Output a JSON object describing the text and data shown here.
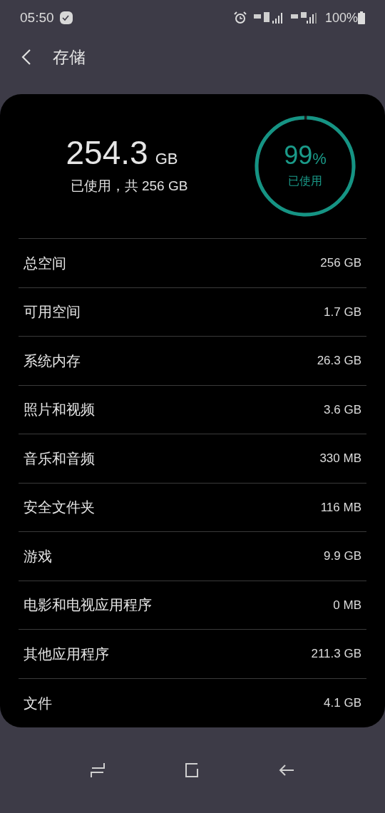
{
  "status_bar": {
    "time": "05:50",
    "battery": "100%"
  },
  "header": {
    "title": "存储"
  },
  "summary": {
    "used": "254.3",
    "unit": "GB",
    "caption": "已使用，共 256 GB",
    "percent": "99",
    "percent_sign": "%",
    "ring_label": "已使用",
    "level": 0.99
  },
  "rows": [
    {
      "label": "总空间",
      "value": "256 GB"
    },
    {
      "label": "可用空间",
      "value": "1.7 GB"
    },
    {
      "label": "系统内存",
      "value": "26.3 GB"
    },
    {
      "label": "照片和视频",
      "value": "3.6 GB"
    },
    {
      "label": "音乐和音频",
      "value": "330 MB"
    },
    {
      "label": "安全文件夹",
      "value": "116 MB"
    },
    {
      "label": "游戏",
      "value": "9.9 GB"
    },
    {
      "label": "电影和电视应用程序",
      "value": "0 MB"
    },
    {
      "label": "其他应用程序",
      "value": "211.3 GB"
    },
    {
      "label": "文件",
      "value": "4.1 GB"
    }
  ]
}
